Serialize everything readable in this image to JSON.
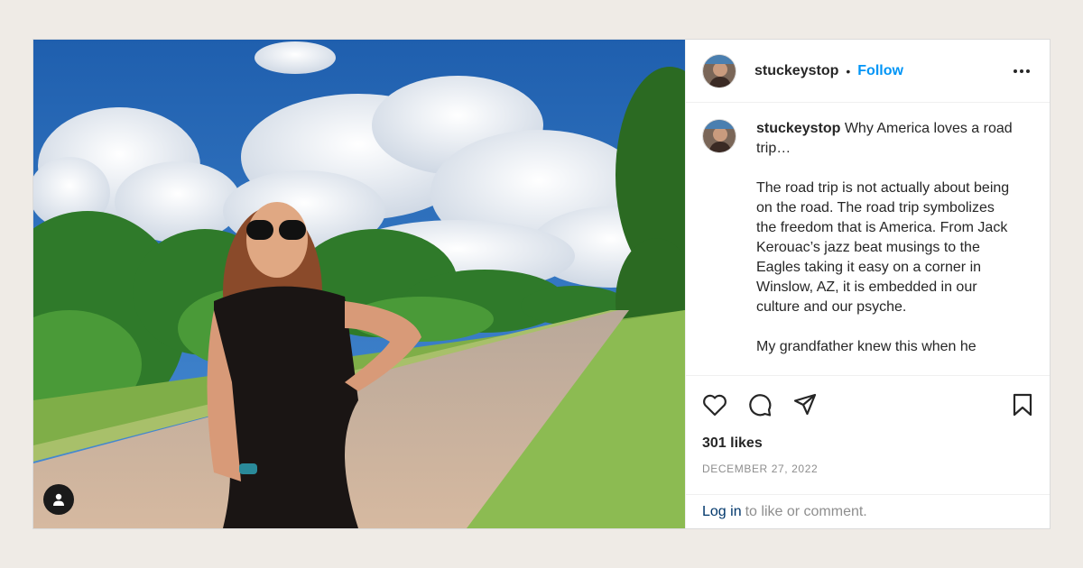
{
  "post": {
    "username": "stuckeystop",
    "follow_label": "Follow",
    "separator": "•",
    "caption_username": "stuckeystop",
    "caption_text": " Why America loves a road trip…\n\nThe road trip is not actually about being on the road. The road trip symbolizes the freedom that is America. From Jack Kerouac’s jazz beat musings to the Eagles taking it easy on a corner in Winslow, AZ, it is embedded in our culture and our psyche.\n\nMy grandfather knew this when he",
    "likes": "301 likes",
    "date": "DECEMBER 27, 2022",
    "login_link": "Log in",
    "login_text": "to like or comment."
  },
  "icons": {
    "like": "heart-icon",
    "comment": "comment-icon",
    "share": "share-icon",
    "save": "bookmark-icon",
    "more": "more-icon",
    "user_tag": "user-icon"
  },
  "colors": {
    "follow": "#0095f6",
    "login_link": "#00376b",
    "muted": "#8e8e8e",
    "text": "#262626",
    "page_bg": "#efebe6"
  }
}
